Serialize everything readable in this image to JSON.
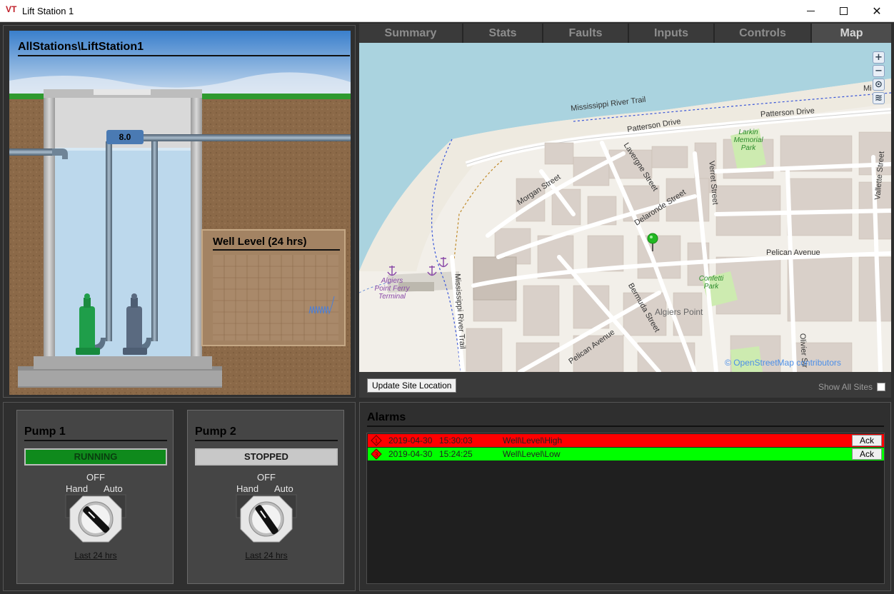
{
  "window": {
    "title": "Lift Station 1",
    "logo_text": "VT",
    "close_glyph": "✕"
  },
  "station": {
    "title": "AllStations\\LiftStation1",
    "level_value": "8.0",
    "chart_title": "Well Level (24 hrs)"
  },
  "tabs": [
    {
      "label": "Summary",
      "active": false
    },
    {
      "label": "Stats",
      "active": false
    },
    {
      "label": "Faults",
      "active": false
    },
    {
      "label": "Inputs",
      "active": false
    },
    {
      "label": "Controls",
      "active": false
    },
    {
      "label": "Map",
      "active": true
    }
  ],
  "map": {
    "update_button": "Update Site Location",
    "show_all_label": "Show All Sites",
    "show_all_checked": false,
    "attribution_prefix": "©",
    "attribution_link": "OpenStreetMap contributors",
    "zoom_in": "+",
    "zoom_out": "−",
    "streets": {
      "river_trail": "Mississippi River Trail",
      "patterson": "Patterson Drive",
      "patterson2": "Patterson Drive",
      "morgan": "Morgan Street",
      "lavergne": "Lavergne Street",
      "delaronde": "Delaronde Street",
      "verret": "Verret Street",
      "vallette": "Vallette Street",
      "pelican": "Pelican Avenue",
      "pelican2": "Pelican Avenue",
      "bermuda": "Bermuda Street",
      "river_trail_v": "Mississippi River Trail",
      "olivier": "Olivier Str",
      "algiers_point": "Algiers Point",
      "ferry": "Algiers Point Ferry Terminal",
      "larkin": "Larkin Memorial Park",
      "confetti": "Confetti Park",
      "edge_label": "Mi"
    }
  },
  "pumps": [
    {
      "title": "Pump 1",
      "status": "RUNNING",
      "status_color": "#0f8a1c",
      "off": "OFF",
      "hand": "Hand",
      "auto": "Auto",
      "link": "Last 24 hrs"
    },
    {
      "title": "Pump 2",
      "status": "STOPPED",
      "status_color": "#c8c8c8",
      "off": "OFF",
      "hand": "Hand",
      "auto": "Auto",
      "link": "Last 24 hrs"
    }
  ],
  "alarms": {
    "title": "Alarms",
    "items": [
      {
        "date": "2019-04-30",
        "time": "15:30:03",
        "description": "Well\\Level\\High",
        "color": "#ff0000",
        "ack": "Ack",
        "severity": "1"
      },
      {
        "date": "2019-04-30",
        "time": "15:24:25",
        "description": "Well\\Level\\Low",
        "color": "#00ff00",
        "ack": "Ack",
        "severity": "3"
      }
    ]
  },
  "colors": {
    "water": "#a9cfe0",
    "well_water": "#bcd8ec",
    "soil": "#8d6a4a",
    "sky": "#3f86d0",
    "grass": "#2f9a2f",
    "pump_running": "#1f9e4a",
    "pump_stopped": "#5a6a80"
  }
}
